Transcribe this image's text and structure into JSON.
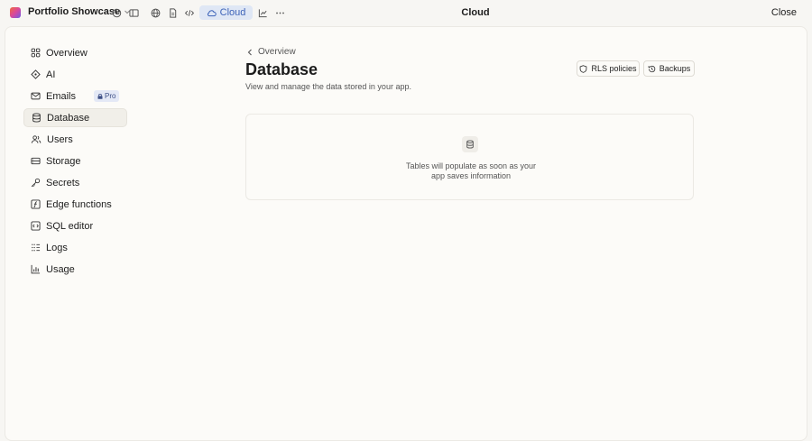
{
  "topbar": {
    "project_name": "Portfolio Showcase",
    "cloud_label": "Cloud",
    "center_title": "Cloud",
    "close_label": "Close"
  },
  "sidebar": {
    "items": [
      {
        "label": "Overview",
        "icon": "grid-icon"
      },
      {
        "label": "AI",
        "icon": "ai-diamond-icon"
      },
      {
        "label": "Emails",
        "icon": "mail-icon",
        "badge": "Pro"
      },
      {
        "label": "Database",
        "icon": "database-icon",
        "active": true
      },
      {
        "label": "Users",
        "icon": "users-icon"
      },
      {
        "label": "Storage",
        "icon": "storage-icon"
      },
      {
        "label": "Secrets",
        "icon": "key-icon"
      },
      {
        "label": "Edge functions",
        "icon": "function-icon"
      },
      {
        "label": "SQL editor",
        "icon": "code-icon"
      },
      {
        "label": "Logs",
        "icon": "logs-icon"
      },
      {
        "label": "Usage",
        "icon": "chart-icon"
      }
    ]
  },
  "main": {
    "breadcrumb": "Overview",
    "title": "Database",
    "subtitle": "View and manage the data stored in your app.",
    "rls_label": "RLS policies",
    "backups_label": "Backups",
    "empty_text": "Tables will populate as soon as your app saves information"
  },
  "colors": {
    "accent": "#3d63b8",
    "cloud_bg": "#dfe7f5",
    "background": "#f7f6f3"
  }
}
